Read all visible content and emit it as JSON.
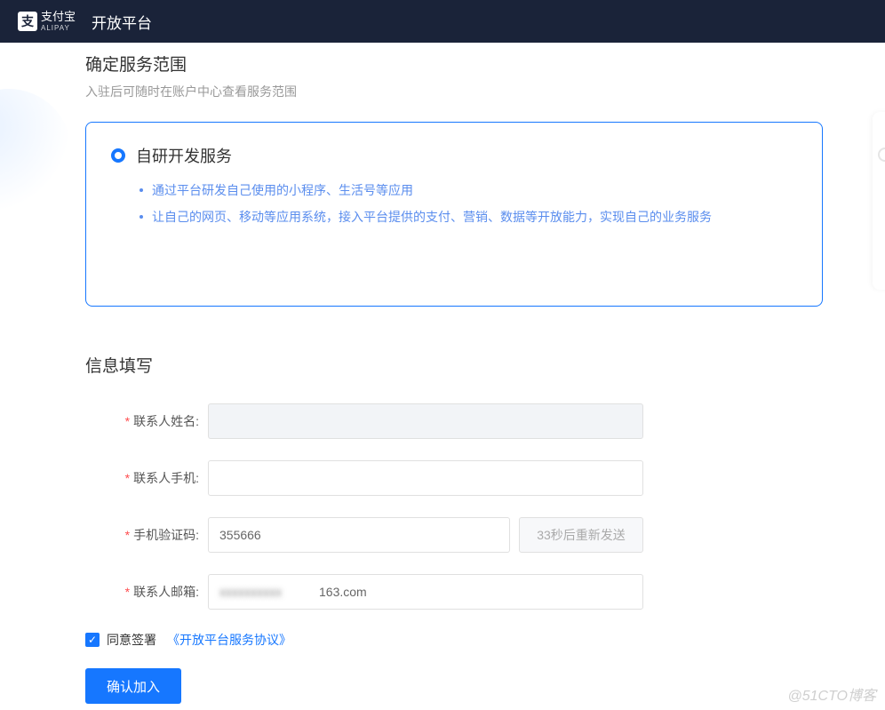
{
  "header": {
    "logo_char": "支",
    "logo_text": "支付宝",
    "logo_sub": "ALIPAY",
    "platform_title": "开放平台"
  },
  "scope": {
    "title": "确定服务范围",
    "subtitle": "入驻后可随时在账户中心查看服务范围",
    "option_label": "自研开发服务",
    "bullets": [
      "通过平台研发自己使用的小程序、生活号等应用",
      "让自己的网页、移动等应用系统，接入平台提供的支付、营销、数据等开放能力，实现自己的业务服务"
    ]
  },
  "form": {
    "title": "信息填写",
    "name_label": "联系人姓名:",
    "name_value": " ",
    "phone_label": "联系人手机:",
    "phone_value": " ",
    "code_label": "手机验证码:",
    "code_value": "355666",
    "resend_label": "33秒后重新发送",
    "email_label": "联系人邮箱:",
    "email_suffix": "163.com",
    "agree_text": "同意签署",
    "agree_link": "《开放平台服务协议》",
    "submit_label": "确认加入"
  },
  "watermark": "@51CTO博客"
}
